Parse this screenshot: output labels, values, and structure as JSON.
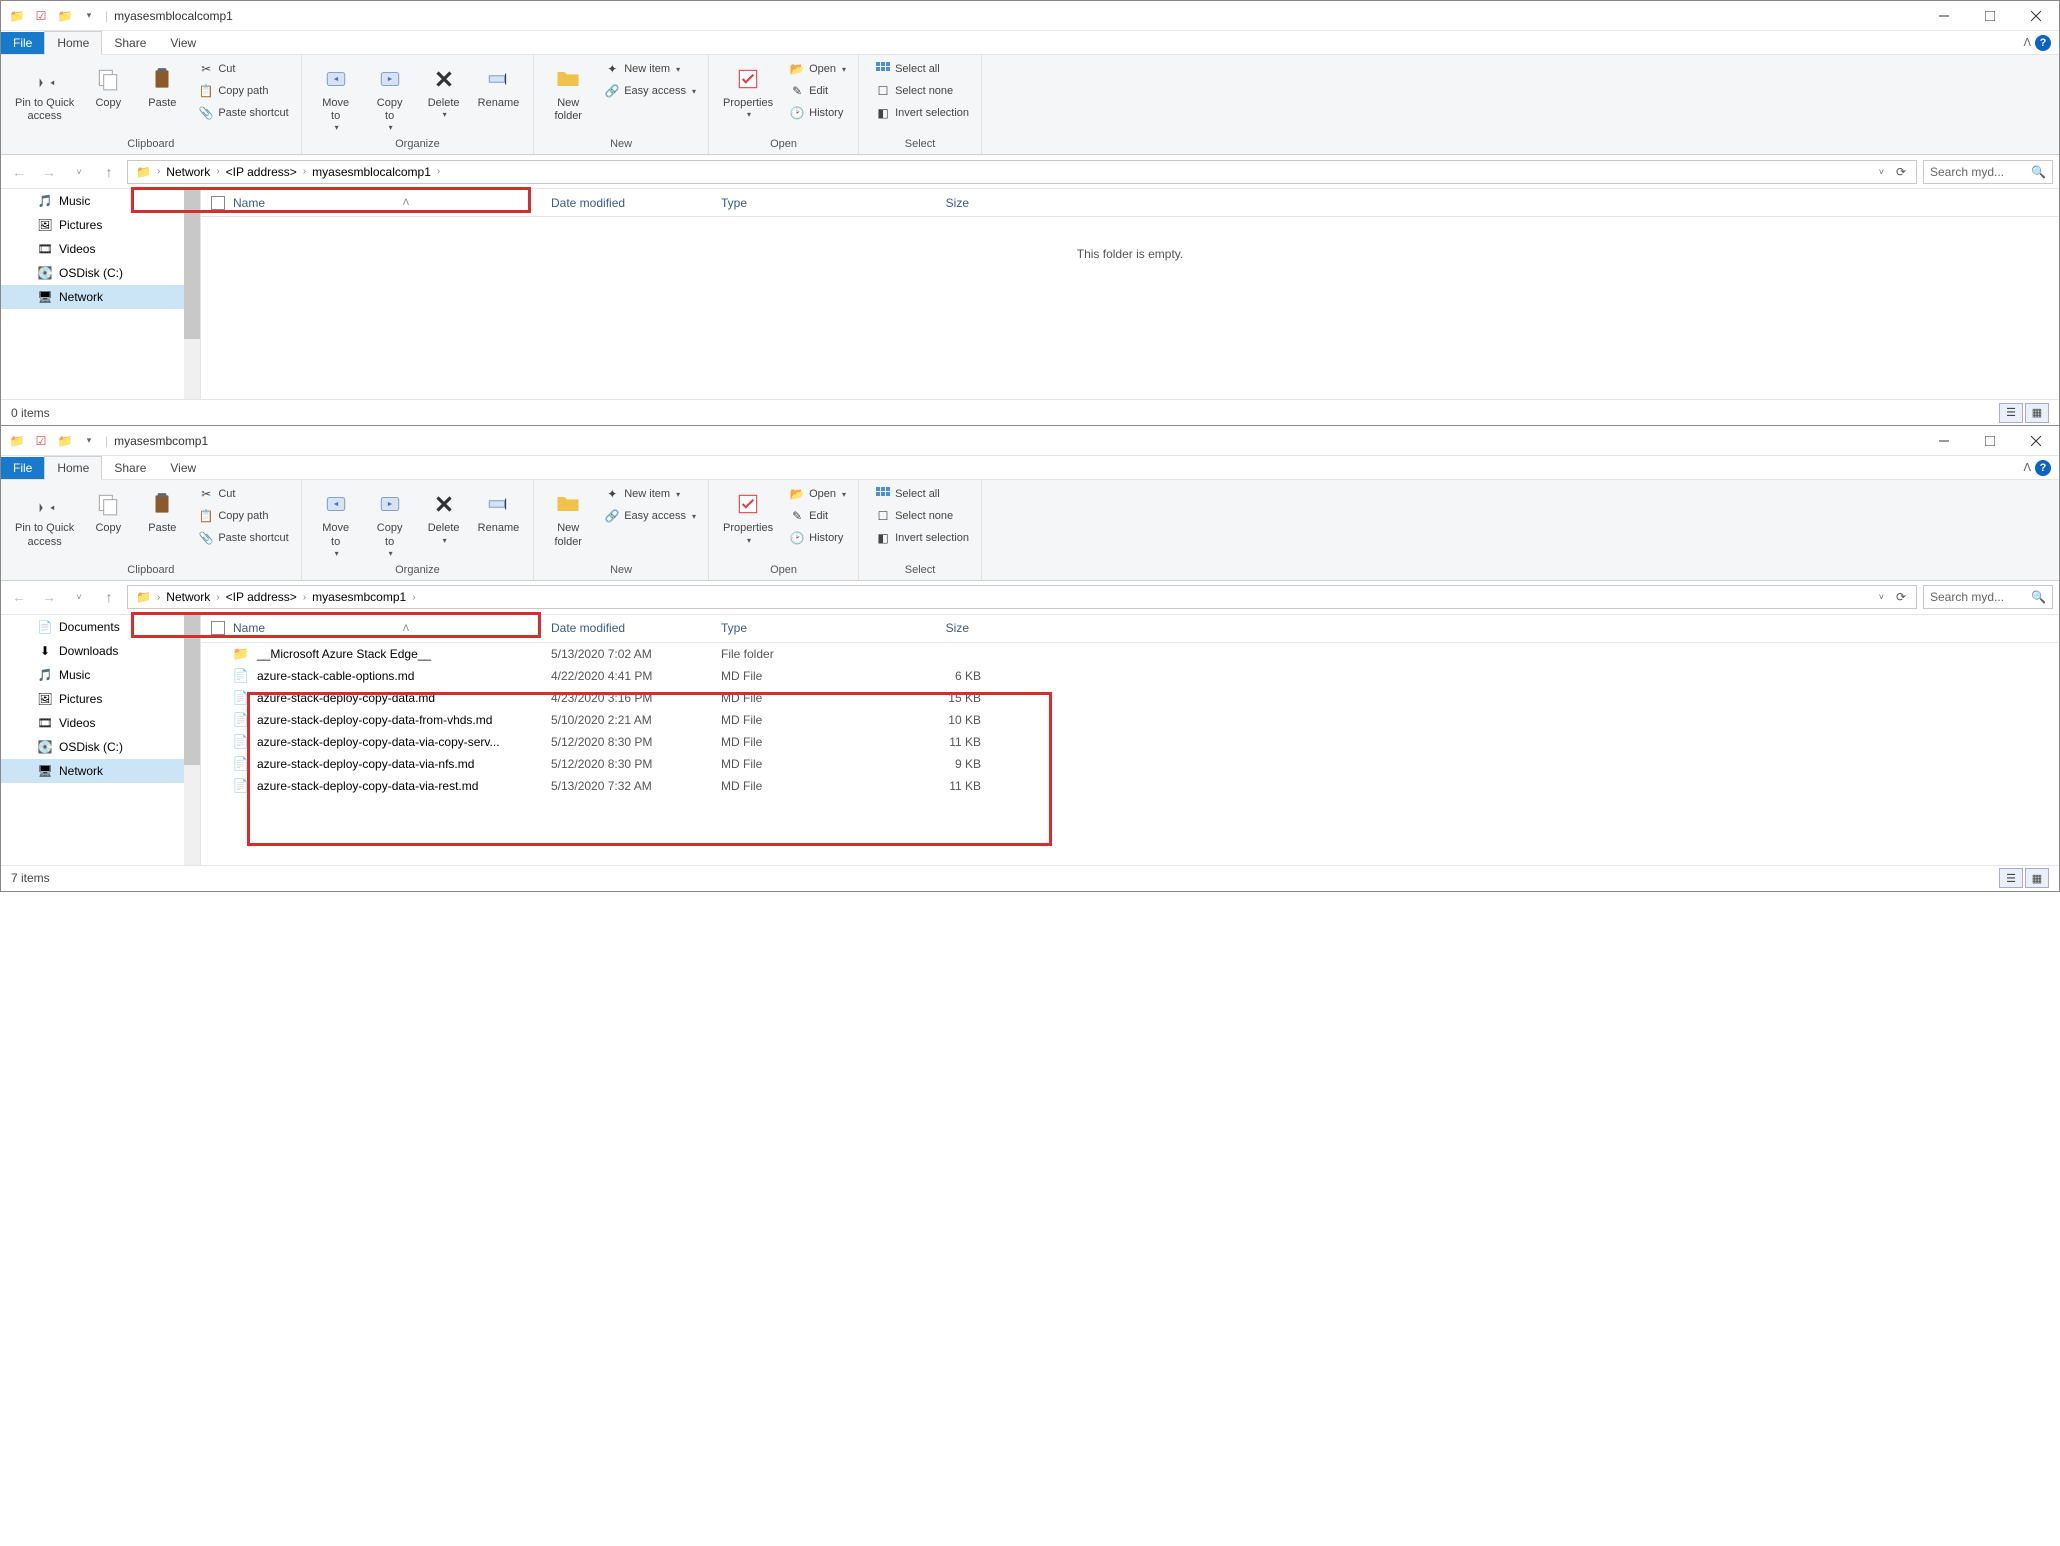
{
  "windows": [
    {
      "title": "myasesmblocalcomp1",
      "menu": {
        "file": "File",
        "home": "Home",
        "share": "Share",
        "view": "View"
      },
      "ribbon": {
        "clipboard": {
          "pin": "Pin to Quick\naccess",
          "copy": "Copy",
          "paste": "Paste",
          "cut": "Cut",
          "copy_path": "Copy path",
          "paste_shortcut": "Paste shortcut",
          "label": "Clipboard"
        },
        "organize": {
          "move": "Move\nto",
          "copy_to": "Copy\nto",
          "delete": "Delete",
          "rename": "Rename",
          "label": "Organize"
        },
        "new": {
          "folder": "New\nfolder",
          "new_item": "New item",
          "easy_access": "Easy access",
          "label": "New"
        },
        "open": {
          "properties": "Properties",
          "open": "Open",
          "edit": "Edit",
          "history": "History",
          "label": "Open"
        },
        "select": {
          "all": "Select all",
          "none": "Select none",
          "invert": "Invert selection",
          "label": "Select"
        }
      },
      "breadcrumb": [
        "Network",
        "<IP address>",
        "myasesmblocalcomp1"
      ],
      "search_placeholder": "Search myd...",
      "nav_items": [
        {
          "icon": "🎵",
          "label": "Music"
        },
        {
          "icon": "🖼",
          "label": "Pictures"
        },
        {
          "icon": "🎞",
          "label": "Videos"
        },
        {
          "icon": "💽",
          "label": "OSDisk (C:)"
        },
        {
          "icon": "🖥",
          "label": "Network",
          "selected": true
        }
      ],
      "columns": {
        "name": "Name",
        "date": "Date modified",
        "type": "Type",
        "size": "Size"
      },
      "empty_text": "This folder is empty.",
      "status": "0 items"
    },
    {
      "title": "myasesmbcomp1",
      "menu": {
        "file": "File",
        "home": "Home",
        "share": "Share",
        "view": "View"
      },
      "ribbon": {
        "clipboard": {
          "pin": "Pin to Quick\naccess",
          "copy": "Copy",
          "paste": "Paste",
          "cut": "Cut",
          "copy_path": "Copy path",
          "paste_shortcut": "Paste shortcut",
          "label": "Clipboard"
        },
        "organize": {
          "move": "Move\nto",
          "copy_to": "Copy\nto",
          "delete": "Delete",
          "rename": "Rename",
          "label": "Organize"
        },
        "new": {
          "folder": "New\nfolder",
          "new_item": "New item",
          "easy_access": "Easy access",
          "label": "New"
        },
        "open": {
          "properties": "Properties",
          "open": "Open",
          "edit": "Edit",
          "history": "History",
          "label": "Open"
        },
        "select": {
          "all": "Select all",
          "none": "Select none",
          "invert": "Invert selection",
          "label": "Select"
        }
      },
      "breadcrumb": [
        "Network",
        "<IP address>",
        "myasesmbcomp1"
      ],
      "search_placeholder": "Search myd...",
      "nav_items": [
        {
          "icon": "📄",
          "label": "Documents"
        },
        {
          "icon": "⬇",
          "label": "Downloads"
        },
        {
          "icon": "🎵",
          "label": "Music"
        },
        {
          "icon": "🖼",
          "label": "Pictures"
        },
        {
          "icon": "🎞",
          "label": "Videos"
        },
        {
          "icon": "💽",
          "label": "OSDisk (C:)"
        },
        {
          "icon": "🖥",
          "label": "Network",
          "selected": true
        }
      ],
      "columns": {
        "name": "Name",
        "date": "Date modified",
        "type": "Type",
        "size": "Size"
      },
      "files": [
        {
          "icon": "📁",
          "name": "__Microsoft Azure Stack Edge__",
          "date": "5/13/2020 7:02 AM",
          "type": "File folder",
          "size": ""
        },
        {
          "icon": "📄",
          "name": "azure-stack-cable-options.md",
          "date": "4/22/2020 4:41 PM",
          "type": "MD File",
          "size": "6 KB"
        },
        {
          "icon": "📄",
          "name": "azure-stack-deploy-copy-data.md",
          "date": "4/23/2020 3:16 PM",
          "type": "MD File",
          "size": "15 KB"
        },
        {
          "icon": "📄",
          "name": "azure-stack-deploy-copy-data-from-vhds.md",
          "date": "5/10/2020 2:21 AM",
          "type": "MD File",
          "size": "10 KB"
        },
        {
          "icon": "📄",
          "name": "azure-stack-deploy-copy-data-via-copy-serv...",
          "date": "5/12/2020 8:30 PM",
          "type": "MD File",
          "size": "11 KB"
        },
        {
          "icon": "📄",
          "name": "azure-stack-deploy-copy-data-via-nfs.md",
          "date": "5/12/2020 8:30 PM",
          "type": "MD File",
          "size": "9 KB"
        },
        {
          "icon": "📄",
          "name": "azure-stack-deploy-copy-data-via-rest.md",
          "date": "5/13/2020 7:32 AM",
          "type": "MD File",
          "size": "11 KB"
        }
      ],
      "status": "7 items"
    }
  ]
}
